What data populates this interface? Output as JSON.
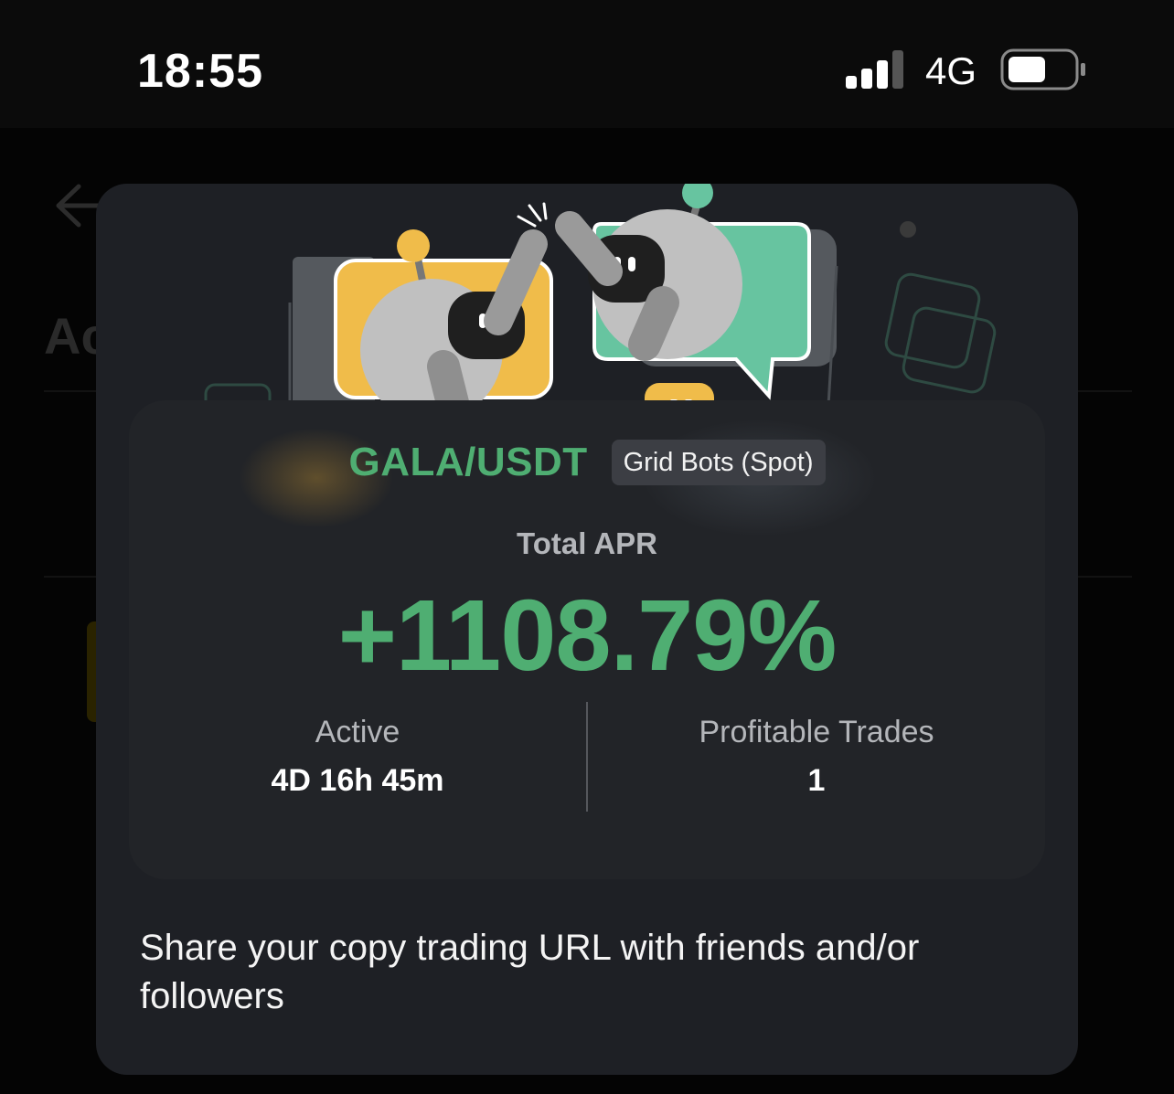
{
  "status_bar": {
    "time": "18:55",
    "network": "4G"
  },
  "background": {
    "heading_fragment": "Ac"
  },
  "card": {
    "pair": "GALA/USDT",
    "bot_type": "Grid Bots (Spot)",
    "apr_label": "Total APR",
    "apr_value": "+1108.79%",
    "stats": [
      {
        "label": "Active",
        "value": "4D 16h 45m"
      },
      {
        "label": "Profitable Trades",
        "value": "1"
      }
    ]
  },
  "share_text": "Share your copy trading URL with friends and/or followers",
  "colors": {
    "accent_green": "#4fae72",
    "modal_bg": "#1e2025",
    "card_bg": "#222428",
    "robot_yellow": "#f0bc4a",
    "robot_teal": "#67c4a0"
  },
  "icons": [
    "signal-icon",
    "battery-icon",
    "back-arrow-icon",
    "robots-illustration"
  ]
}
